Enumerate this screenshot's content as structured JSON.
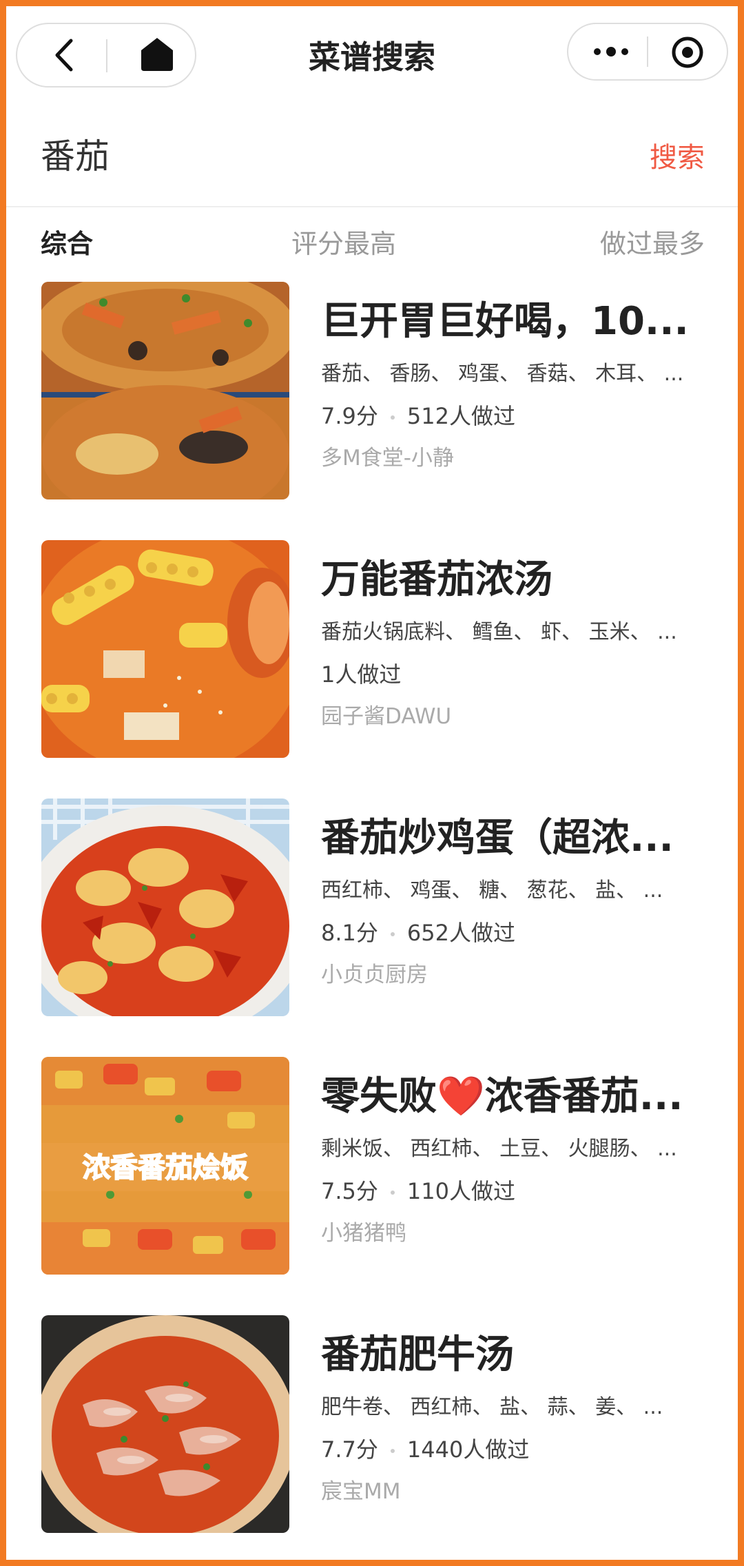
{
  "nav": {
    "title": "菜谱搜索"
  },
  "search": {
    "query": "番茄",
    "button_label": "搜索"
  },
  "tabs": [
    {
      "label": "综合",
      "active": true
    },
    {
      "label": "评分最高",
      "active": false
    },
    {
      "label": "做过最多",
      "active": false
    }
  ],
  "recipes": [
    {
      "title": "巨开胃巨好喝，10...",
      "ingredients": "番茄、 香肠、 鸡蛋、 香菇、 木耳、 ...",
      "rating": "7.9分",
      "cooked": "512人做过",
      "author": "多M食堂-小静",
      "image_label": ""
    },
    {
      "title": "万能番茄浓汤",
      "ingredients": "番茄火锅底料、 鳕鱼、 虾、 玉米、 ...",
      "rating": "",
      "cooked": "1人做过",
      "author": "园子酱DAWU",
      "image_label": ""
    },
    {
      "title": "番茄炒鸡蛋（超浓...",
      "ingredients": "西红柿、 鸡蛋、 糖、 葱花、 盐、 ...",
      "rating": "8.1分",
      "cooked": "652人做过",
      "author": "小贞贞厨房",
      "image_label": ""
    },
    {
      "title": "零失败❤️浓香番茄...",
      "ingredients": "剩米饭、 西红柿、 土豆、 火腿肠、 ...",
      "rating": "7.5分",
      "cooked": "110人做过",
      "author": "小猪猪鸭",
      "image_label": "浓香番茄烩饭"
    },
    {
      "title": "番茄肥牛汤",
      "ingredients": "肥牛卷、 西红柿、 盐、 蒜、 姜、 ...",
      "rating": "7.7分",
      "cooked": "1440人做过",
      "author": "宸宝MM",
      "image_label": ""
    }
  ],
  "colors": {
    "frame": "#f27a22",
    "accent": "#f05a44",
    "text_primary": "#222222",
    "text_muted": "#aaaaaa"
  }
}
